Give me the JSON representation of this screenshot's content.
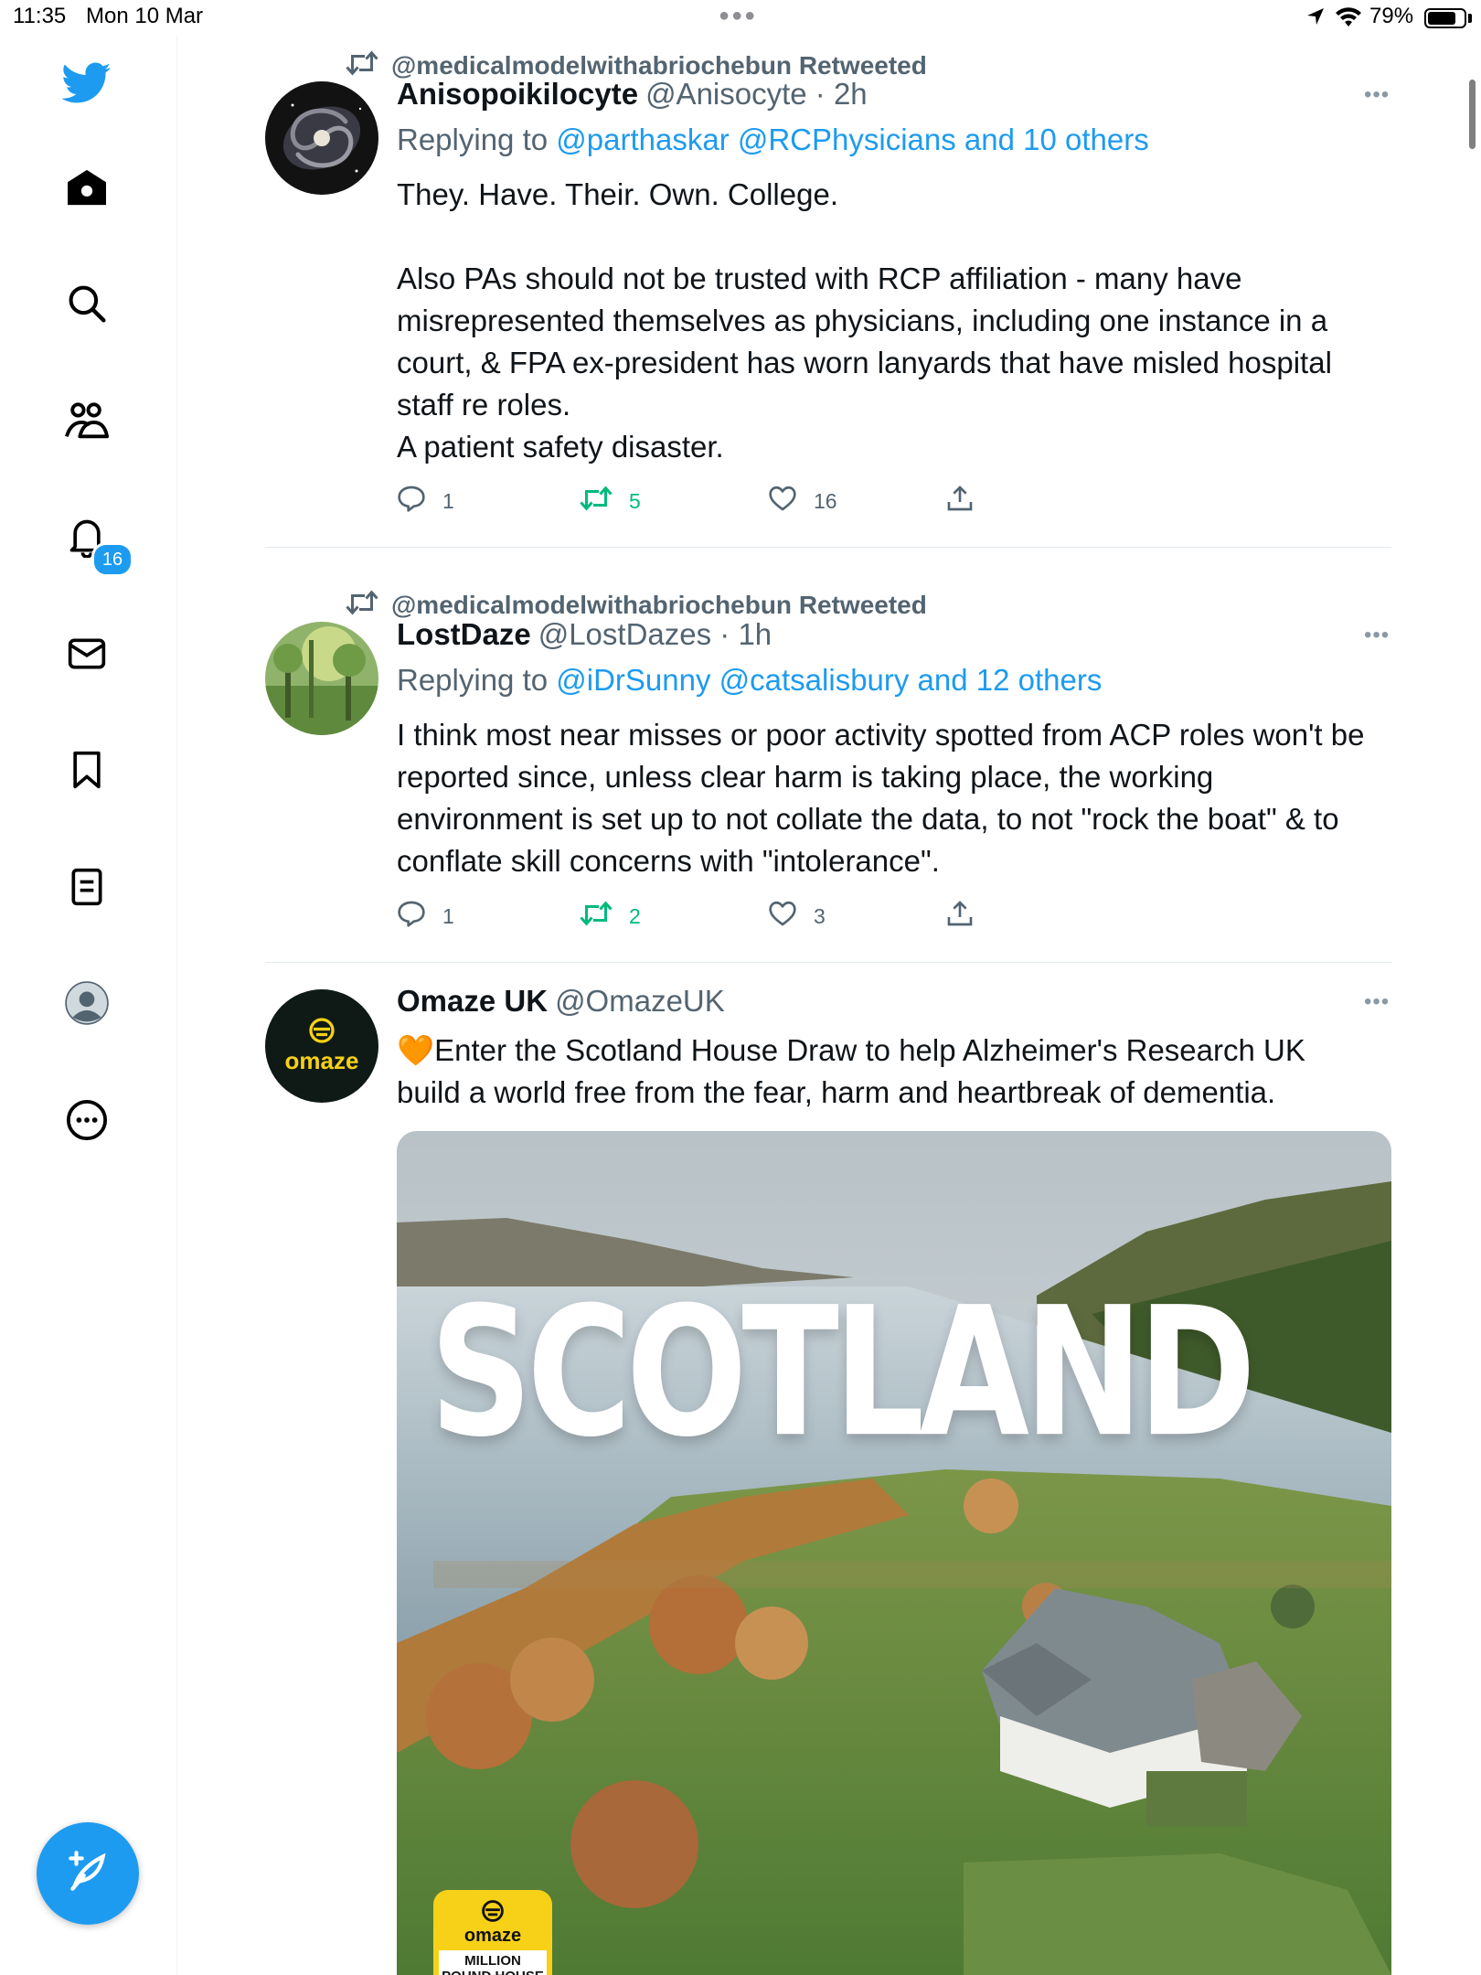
{
  "status_bar": {
    "time": "11:35",
    "date": "Mon 10 Mar",
    "battery_percent": "79%",
    "battery_level": 0.79
  },
  "sidebar": {
    "items": [
      {
        "name": "twitter-logo",
        "icon": "bird-icon"
      },
      {
        "name": "home",
        "icon": "home-icon"
      },
      {
        "name": "explore",
        "icon": "search-icon"
      },
      {
        "name": "communities",
        "icon": "people-icon"
      },
      {
        "name": "notifications",
        "icon": "bell-icon",
        "badge": "16"
      },
      {
        "name": "messages",
        "icon": "mail-icon"
      },
      {
        "name": "bookmarks",
        "icon": "bookmark-icon"
      },
      {
        "name": "lists",
        "icon": "list-icon"
      },
      {
        "name": "profile",
        "icon": "avatar-icon"
      },
      {
        "name": "more",
        "icon": "more-circle-icon"
      }
    ],
    "compose_icon": "compose-feather-icon"
  },
  "colors": {
    "accent": "#1d9bf0",
    "retweet_green": "#00ba7c",
    "secondary_text": "#536471"
  },
  "tweets": [
    {
      "retweeted_by": "@medicalmodelwithabriochebun Retweeted",
      "name": "Anisopoikilocyte",
      "handle": "@Anisocyte · 2h",
      "replying_prefix": "Replying to ",
      "replying_to": "@parthaskar @RCPhysicians and 10 others",
      "text": "They. Have. Their. Own. College.\n\nAlso PAs should not be trusted with RCP affiliation - many have misrepresented themselves as physicians, including one instance in a court, & FPA ex-president has worn lanyards that have misled hospital staff re roles.\nA patient safety disaster.",
      "replies": "1",
      "retweets": "5",
      "likes": "16",
      "more": "•••"
    },
    {
      "retweeted_by": "@medicalmodelwithabriochebun Retweeted",
      "name": "LostDaze",
      "handle": "@LostDazes · 1h",
      "replying_prefix": "Replying to ",
      "replying_to": "@iDrSunny @catsalisbury and 12 others",
      "text": "I think most near misses or poor activity spotted from ACP roles won't be reported since, unless clear harm is taking place, the working environment is set up to not collate the data, to not \"rock the boat\" & to conflate skill concerns with \"intolerance\".",
      "replies": "1",
      "retweets": "2",
      "likes": "3",
      "more": "•••"
    },
    {
      "name": "Omaze UK",
      "handle": "@OmazeUK",
      "avatar_text": "omaze",
      "text": "🧡Enter the Scotland House Draw to help Alzheimer's Research UK build a world free from the fear, harm and heartbreak of dementia.",
      "more": "•••",
      "media": {
        "headline": "SCOTLAND",
        "badge_brand": "omaze",
        "badge_text": "MILLION POUND HOUSE DRAW"
      }
    }
  ]
}
